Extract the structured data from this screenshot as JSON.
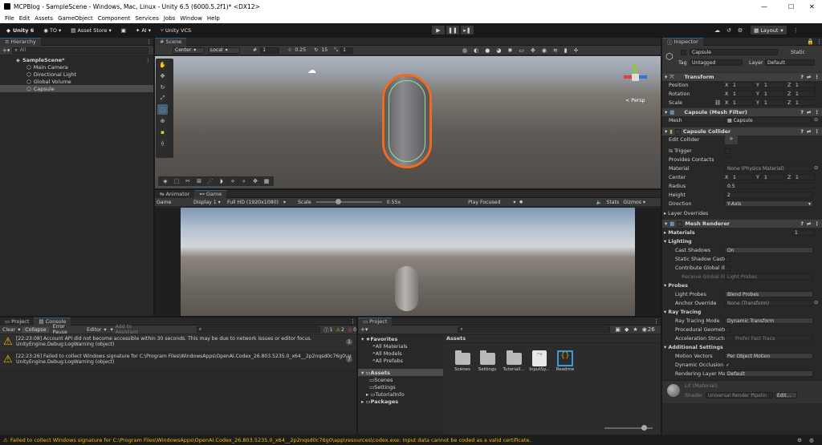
{
  "window": {
    "title": "MCPBlog - SampleScene - Windows, Mac, Linux - Unity 6.5 (6000.5.2f1)* <DX12>",
    "minimize": "—",
    "maximize": "☐",
    "close": "✕"
  },
  "menu": [
    "File",
    "Edit",
    "Assets",
    "GameObject",
    "Component",
    "Services",
    "Jobs",
    "Window",
    "Help"
  ],
  "toolbar": {
    "account": "Unity 6",
    "to": "TO",
    "asset_store": "Asset Store",
    "ai": "AI",
    "vcs": "Unity VCS",
    "layout": "Layout"
  },
  "hierarchy": {
    "tab": "Hierarchy",
    "search_placeholder": "All",
    "scene": "SampleScene*",
    "items": [
      "Main Camera",
      "Directional Light",
      "Global Volume",
      "Capsule"
    ]
  },
  "scene": {
    "tab": "Scene",
    "pivot": "Center",
    "space": "Local",
    "grid_value": "1",
    "snap_value": "0.25",
    "rotate_snap": "15",
    "scale_snap": "1",
    "persp_label": "< Persp"
  },
  "game": {
    "tabs": [
      "Animator",
      "Game"
    ],
    "mode": "Game",
    "display": "Display 1",
    "resolution": "Full HD (1920x1080)",
    "scale_label": "Scale",
    "scale_value": "0.55x",
    "play_focused": "Play Focused",
    "stats": "Stats",
    "gizmos": "Gizmos"
  },
  "console": {
    "tabs": [
      "Project",
      "Console"
    ],
    "buttons": [
      "Clear",
      "Collapse",
      "Error Pause",
      "Editor"
    ],
    "add_to_assistant": "Add to Assistant",
    "counts": {
      "info": "1",
      "warn": "2",
      "error": "0"
    },
    "messages": [
      {
        "line1": "[22:23:08] Account API did not become accessible within 30 seconds. This may be due to network issues or editor focus.",
        "line2": "UnityEngine.Debug:LogWarning (object)",
        "count": "1"
      },
      {
        "line1": "[22:23:26] Failed to collect Windows signature for C:\\Program Files\\WindowsApps\\OpenAI.Codex_26.803.5235.0_x64__2p2nqsd0c76g0\\app",
        "line2": "UnityEngine.Debug:LogWarning (object)",
        "count": "7"
      }
    ]
  },
  "project": {
    "tab": "Project",
    "favorites": "Favorites",
    "fav_items": [
      "All Materials",
      "All Models",
      "All Prefabs"
    ],
    "assets": "Assets",
    "asset_tree": [
      "Scenes",
      "Settings",
      "TutorialInfo"
    ],
    "packages": "Packages",
    "assets_header": "Assets",
    "asset_items": [
      "Scenes",
      "Settings",
      "TutorialI...",
      "InputSy...",
      "Readme"
    ],
    "item_count": "26"
  },
  "inspector": {
    "tab": "Inspector",
    "name": "Capsule",
    "static": "Static",
    "tag_label": "Tag",
    "tag": "Untagged",
    "layer_label": "Layer",
    "layer": "Default",
    "transform": {
      "title": "Transform",
      "position_label": "Position",
      "rotation_label": "Rotation",
      "scale_label": "Scale",
      "position": [
        "1",
        "1",
        "1"
      ],
      "rotation": [
        "1",
        "1",
        "1"
      ],
      "scale": [
        "1",
        "1",
        "1"
      ]
    },
    "mesh_filter": {
      "title": "Capsule (Mesh Filter)",
      "mesh_label": "Mesh",
      "mesh": "Capsule"
    },
    "collider": {
      "title": "Capsule Collider",
      "edit_label": "Edit Collider",
      "is_trigger": "Is Trigger",
      "provides_contacts": "Provides Contacts",
      "material_label": "Material",
      "material": "None (Physics Material)",
      "center_label": "Center",
      "center": [
        "1",
        "1",
        "1"
      ],
      "radius_label": "Radius",
      "radius": "0.5",
      "height_label": "Height",
      "height": "2",
      "direction_label": "Direction",
      "direction": "Y-Axis",
      "layer_overrides": "Layer Overrides"
    },
    "mesh_renderer": {
      "title": "Mesh Renderer",
      "materials": "Materials",
      "materials_count": "1",
      "lighting": "Lighting",
      "cast_shadows_label": "Cast Shadows",
      "cast_shadows": "On",
      "static_shadow": "Static Shadow Caste",
      "contribute_gi": "Contribute Global Illi",
      "receive_gi": "Receive Global Illi",
      "receive_gi_value": "Light Probes",
      "probes": "Probes",
      "light_probes_label": "Light Probes",
      "light_probes": "Blend Probes",
      "anchor_label": "Anchor Override",
      "anchor": "None (Transform)",
      "ray_tracing": "Ray Tracing",
      "rt_mode_label": "Ray Tracing Mode",
      "rt_mode": "Dynamic Transform",
      "procedural": "Procedural Geometry",
      "accel_label": "Acceleration Structu",
      "accel": "Prefer Fast Trace",
      "additional": "Additional Settings",
      "motion_label": "Motion Vectors",
      "motion": "Per Object Motion",
      "occlusion": "Dynamic Occlusion",
      "rendering_layer_label": "Rendering Layer Mas",
      "rendering_layer": "Default"
    },
    "material": {
      "name": "Lit (Material)",
      "shader_label": "Shader",
      "shader": "Universal Render Pipelin",
      "edit": "Edit..."
    }
  },
  "status": "Failed to collect Windows signature for C:\\Program Files\\WindowsApps\\OpenAI.Codex_26.803.5235.0_x64__2p2nqsd0c76g0\\app\\resources\\codex.exe: Input data cannot be coded as a valid certificate.",
  "colors": {
    "accent": "#2c5d87",
    "warning": "#f4bc02",
    "selection_outline": "#f26b1d",
    "status_text": "#f4bc02"
  }
}
